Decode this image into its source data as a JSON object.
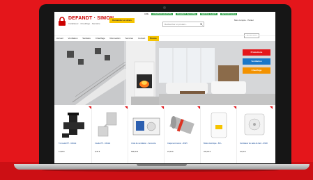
{
  "site": {
    "brand": "DEFANDT · SIMON",
    "brand_tagline": "Installateur · Chauffage · Sanitaire",
    "quote_button": "Demander un devis",
    "top_bar": [
      "AIDE",
      "LIVRAISON GRATUITE",
      "PAIEMENT SÉCURISÉ",
      "SERVICE CLIENT",
      "RETOUR FACILE"
    ],
    "search_placeholder": "Rechercher un produit...",
    "account_label": "Mon compte",
    "cart_label": "Panier",
    "login_label": "Connexion",
    "register_label": "Inscription"
  },
  "nav": {
    "items": [
      "Accueil",
      "Ventilation",
      "Sanitaire",
      "Chauffage",
      "Rénovation",
      "Services",
      "Contact"
    ],
    "promo": "Promo"
  },
  "hero": {
    "cta": [
      {
        "label": "Promotions",
        "color": "#e4161b"
      },
      {
        "label": "Ventilation",
        "color": "#1a77c8"
      },
      {
        "label": "Chauffage",
        "color": "#f39200"
      }
    ]
  },
  "products": [
    {
      "title": "Té coudé PP - Ubbink",
      "price": "12,95 €",
      "icon": "pipe-fitting-icon"
    },
    {
      "title": "Coude PP - Ubbink",
      "price": "8,45 €",
      "icon": "elbow-icon"
    },
    {
      "title": "Unité de ventilation - Vent-Axia",
      "price": "599,00 €",
      "icon": "ventilation-unit-icon"
    },
    {
      "title": "Clapet anti-retour - Ø125",
      "price": "24,50 €",
      "icon": "duct-damper-icon"
    },
    {
      "title": "Boiler électrique - 80 L",
      "price": "329,00 €",
      "icon": "water-heater-icon"
    },
    {
      "title": "Ventilateur de salle de bain - Ø100",
      "price": "42,90 €",
      "icon": "bathroom-fan-icon"
    }
  ],
  "colors": {
    "brand_red": "#e4161b",
    "promo_yellow": "#f6c400",
    "link_blue": "#1a4e9a"
  }
}
